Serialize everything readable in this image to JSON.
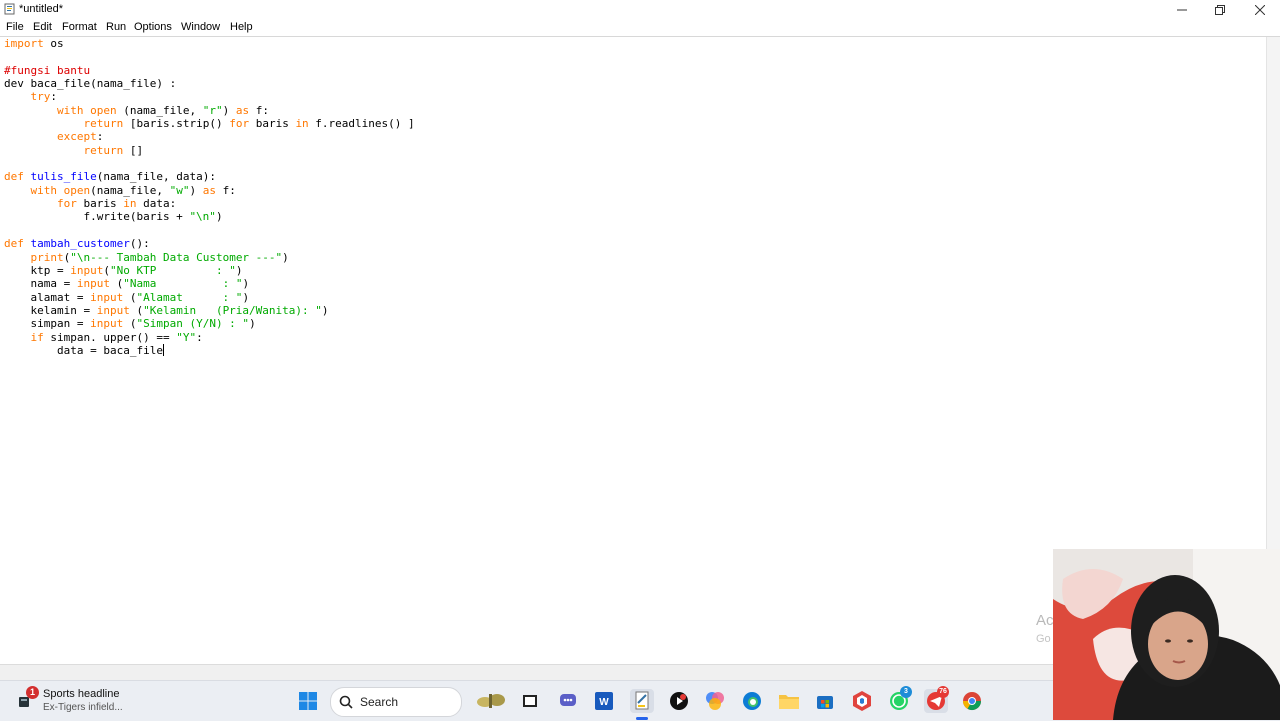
{
  "window": {
    "title": "*untitled*"
  },
  "menu": [
    "File",
    "Edit",
    "Format",
    "Run",
    "Options",
    "Window",
    "Help"
  ],
  "code_lines": [
    "import os",
    "",
    "#fungsi bantu",
    "dev baca_file(nama_file) :",
    "    try:",
    "        with open (nama_file, \"r\") as f:",
    "            return [baris.strip() for baris in f.readlines() ]",
    "        except:",
    "            return []",
    "",
    "def tulis_file(nama_file, data):",
    "    with open(nama_file, \"w\") as f:",
    "        for baris in data:",
    "            f.write(baris + \"\\n\")",
    "",
    "def tambah_customer():",
    "    print(\"\\n--- Tambah Data Customer ---\")",
    "    ktp = input(\"No KTP         : \")",
    "    nama = input (\"Nama          : \")",
    "    alamat = input (\"Alamat      : \")",
    "    kelamin = input (\"Kelamin   (Pria/Wanita): \")",
    "    simpan = input (\"Simpan (Y/N) : \")",
    "    if simpan. upper() == \"Y\":",
    "        data = baca_file"
  ],
  "taskbar": {
    "news_title": "Sports headline",
    "news_subtitle": "Ex-Tigers infield...",
    "news_badge": "1",
    "search_label": "Search",
    "whatsapp_badge": "3",
    "telegram_badge": "76"
  },
  "overlay": {
    "watermark_line1": "Ac",
    "watermark_line2": "Go"
  },
  "colors": {
    "keyword": "#ff7700",
    "string": "#00aa00",
    "comment": "#dd0000",
    "definition": "#0000ff"
  }
}
